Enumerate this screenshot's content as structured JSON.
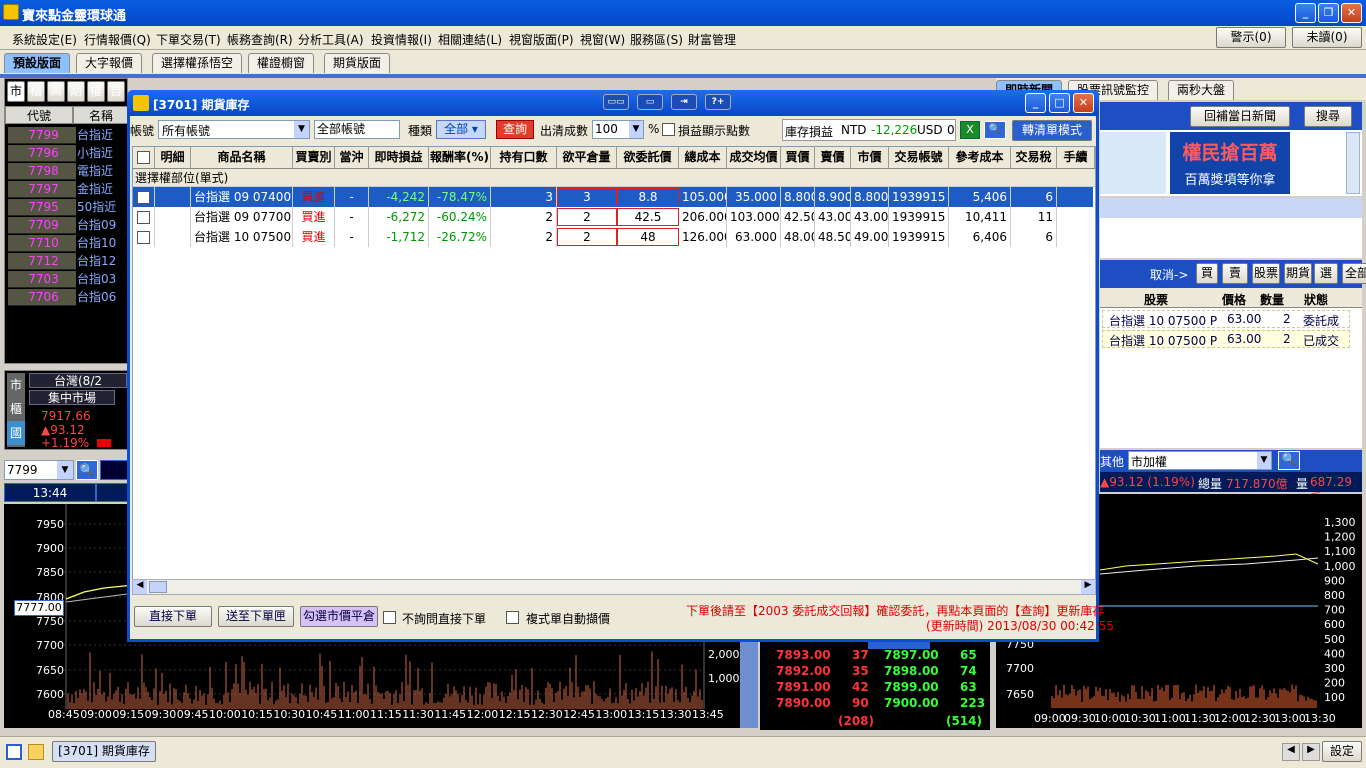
{
  "app": {
    "title": "寶來點金靈環球通"
  },
  "menu": [
    "系統設定(E)",
    "行情報價(Q)",
    "下單交易(T)",
    "帳務查詢(R)",
    "分析工具(A)",
    "投資情報(I)",
    "相關連結(L)",
    "視窗版面(P)",
    "視窗(W)",
    "服務區(S)",
    "財富管理"
  ],
  "menu_right": {
    "alert": "警示(0)",
    "unread": "未讀(0)"
  },
  "tabs": [
    "預設版面",
    "大字報價",
    "選擇權孫悟空",
    "權證櫥窗",
    "期貨版面"
  ],
  "left": {
    "market_buttons": [
      "市",
      "櫃",
      "興",
      "期",
      "權",
      "自"
    ],
    "quote_header": {
      "code": "代號",
      "name": "名稱"
    },
    "quotes": [
      {
        "code": "7799",
        "name": "台指近"
      },
      {
        "code": "7796",
        "name": "小指近"
      },
      {
        "code": "7798",
        "name": "電指近"
      },
      {
        "code": "7797",
        "name": "金指近"
      },
      {
        "code": "7795",
        "name": "50指近"
      },
      {
        "code": "7709",
        "name": "台指09"
      },
      {
        "code": "7710",
        "name": "台指10"
      },
      {
        "code": "7712",
        "name": "台指12"
      },
      {
        "code": "7703",
        "name": "台指03"
      },
      {
        "code": "7706",
        "name": "台指06"
      }
    ],
    "side_tabs": [
      "市",
      "櫃",
      "國"
    ],
    "market_title": "台灣(8/2",
    "market_name": "集中市場",
    "index_value": "7917.66",
    "index_change": "▲93.12",
    "index_pct": "+1.19%",
    "symbol_select": "7799",
    "time": "13:44",
    "price_tag": "7777.00"
  },
  "chart_left": {
    "y_ticks": [
      "7950",
      "7900",
      "7850",
      "7800",
      "7750",
      "7700",
      "7650",
      "7600"
    ],
    "vol_ticks": [
      "2,000",
      "1,000"
    ],
    "x_ticks": [
      "08:45",
      "09:00",
      "09:15",
      "09:30",
      "09:45",
      "10:00",
      "10:15",
      "10:30",
      "10:45",
      "11:00",
      "11:15",
      "11:30",
      "11:45",
      "12:00",
      "12:15",
      "12:30",
      "12:45",
      "13:00",
      "13:15",
      "13:30",
      "13:45"
    ]
  },
  "orderbook": {
    "rows": [
      {
        "bid": "7893.00",
        "bq": "37",
        "ask": "7897.00",
        "aq": "65"
      },
      {
        "bid": "7892.00",
        "bq": "35",
        "ask": "7898.00",
        "aq": "74"
      },
      {
        "bid": "7891.00",
        "bq": "42",
        "ask": "7899.00",
        "aq": "63"
      },
      {
        "bid": "7890.00",
        "bq": "90",
        "ask": "7900.00",
        "aq": "223"
      }
    ],
    "bid_total": "(208)",
    "ask_total": "(514)"
  },
  "right": {
    "tabs": [
      "即時新聞",
      "股票訊號監控",
      "兩秒大盤"
    ],
    "news_buttons": {
      "replay": "回補當日新聞",
      "search": "搜尋"
    },
    "ad_text": "權民搶百萬",
    "ad_sub": "百萬獎項等你拿",
    "cancel_label": "取消->",
    "order_buttons": [
      "買",
      "賣",
      "股票",
      "期貨",
      "選",
      "全部"
    ],
    "order_headers": [
      "股票",
      "價格",
      "數量",
      "狀態"
    ],
    "orders": [
      {
        "name": "台指選 10 07500 P",
        "price": "63.00",
        "qty": "2",
        "status": "委託成功"
      },
      {
        "name": "台指選 10 07500 P",
        "price": "63.00",
        "qty": "2",
        "status": "已成交"
      }
    ],
    "other_label": "其他",
    "market_select": "市加權",
    "ticker": {
      "change": "▲93.12 (1.19%)",
      "vol_label": "總量",
      "vol_value": "717.870億",
      "qty_label": "量",
      "qty_value": "687.29千"
    },
    "y_ticks": [
      "7750",
      "7700",
      "7650"
    ],
    "vol_ticks": [
      "1,300",
      "1,200",
      "1,100",
      "1,000",
      "900",
      "800",
      "700",
      "600",
      "500",
      "400",
      "300",
      "200",
      "100"
    ],
    "x_ticks": [
      "09:00",
      "09:30",
      "10:00",
      "10:30",
      "11:00",
      "11:30",
      "12:00",
      "12:30",
      "13:00",
      "13:30"
    ]
  },
  "dialog": {
    "title": "[3701] 期貨庫存",
    "account_label": "帳號",
    "account_value": "所有帳號",
    "all_accounts": "全部帳號",
    "type_label": "種類",
    "type_value": "全部",
    "query_button": "查詢",
    "fill_label": "出清成數",
    "fill_value": "100",
    "pct": "%",
    "show_pnl_label": "損益顯示點數",
    "inv_pnl_label": "庫存損益",
    "ntd_label": "NTD",
    "ntd_value": "-12,226",
    "usd_label": "USD",
    "usd_value": "0",
    "convert_button": "轉清單模式",
    "columns": [
      "明細",
      "商品名稱",
      "買賣別",
      "當沖",
      "即時損益",
      "報酬率(%)",
      "持有口數",
      "欲平倉量",
      "欲委託價",
      "總成本",
      "成交均價",
      "買價",
      "賣價",
      "市價",
      "交易帳號",
      "參考成本",
      "交易稅",
      "手續"
    ],
    "group_label": "選擇權部位(單式)",
    "rows": [
      {
        "name": "台指選 09 07400 P",
        "side": "買進",
        "day": "-",
        "pnl": "-4,242",
        "ret": "-78.47%",
        "hold": "3",
        "close": "3",
        "price": "8.8",
        "cost": "105.000",
        "avg": "35.000",
        "bid": "8.800",
        "ask": "8.900",
        "mkt": "8.800",
        "acct": "1939915",
        "ref": "5,406",
        "tax": "6"
      },
      {
        "name": "台指選 09 07700 P",
        "side": "買進",
        "day": "-",
        "pnl": "-6,272",
        "ret": "-60.24%",
        "hold": "2",
        "close": "2",
        "price": "42.5",
        "cost": "206.000",
        "avg": "103.000",
        "bid": "42.500",
        "ask": "43.000",
        "mkt": "43.000",
        "acct": "1939915",
        "ref": "10,411",
        "tax": "11"
      },
      {
        "name": "台指選 10 07500 P",
        "side": "買進",
        "day": "-",
        "pnl": "-1,712",
        "ret": "-26.72%",
        "hold": "2",
        "close": "2",
        "price": "48",
        "cost": "126.000",
        "avg": "63.000",
        "bid": "48.000",
        "ask": "48.500",
        "mkt": "49.000",
        "acct": "1939915",
        "ref": "6,406",
        "tax": "6"
      }
    ],
    "btn_direct": "直接下單",
    "btn_send": "送至下單匣",
    "btn_mkt": "勾選市價平倉",
    "chk_noask": "不詢問直接下單",
    "chk_auto": "複式單自動擷價",
    "notice": "下單後請至【2003 委託成交回報】確認委託，再點本頁面的【查詢】更新庫存",
    "update_time": "(更新時間) 2013/08/30 00:42:55"
  },
  "taskbar": {
    "item": "[3701] 期貨庫存",
    "settings": "設定"
  }
}
